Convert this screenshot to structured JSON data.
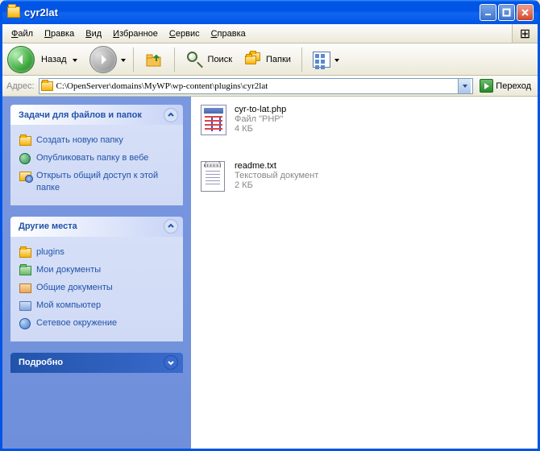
{
  "window": {
    "title": "cyr2lat"
  },
  "menu": {
    "file": {
      "label": "Файл",
      "ul": "Ф"
    },
    "edit": {
      "label": "Правка",
      "ul": "П"
    },
    "view": {
      "label": "Вид",
      "ul": "В"
    },
    "favorites": {
      "label": "Избранное",
      "ul": "И"
    },
    "tools": {
      "label": "Сервис",
      "ul": "С"
    },
    "help": {
      "label": "Справка",
      "ul": "С"
    }
  },
  "toolbar": {
    "back": "Назад",
    "search": "Поиск",
    "folders": "Папки"
  },
  "address": {
    "label": "Адрес:",
    "path": "C:\\OpenServer\\domains\\MyWP\\wp-content\\plugins\\cyr2lat",
    "go": "Переход"
  },
  "tasks": {
    "files_header": "Задачи для файлов и папок",
    "new_folder": "Создать новую папку",
    "publish": "Опубликовать папку в вебе",
    "share": "Открыть общий доступ к этой папке"
  },
  "places": {
    "header": "Другие места",
    "plugins": "plugins",
    "mydocs": "Мои документы",
    "shared": "Общие документы",
    "mycomp": "Мой компьютер",
    "network": "Сетевое окружение"
  },
  "details": {
    "header": "Подробно"
  },
  "files": [
    {
      "name": "cyr-to-lat.php",
      "type": "Файл \"PHP\"",
      "size": "4 КБ"
    },
    {
      "name": "readme.txt",
      "type": "Текстовый документ",
      "size": "2 КБ"
    }
  ]
}
